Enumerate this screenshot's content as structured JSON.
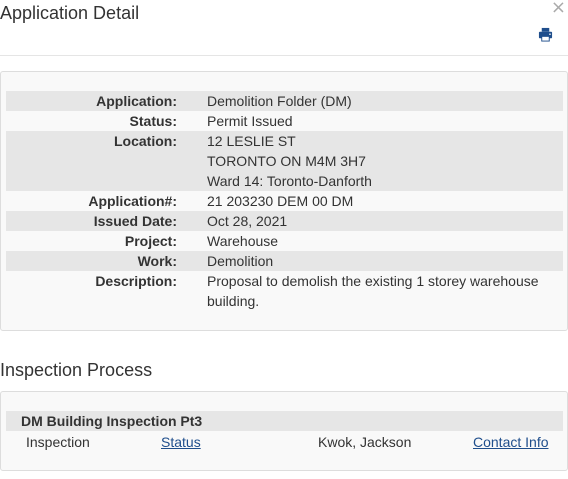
{
  "header": {
    "title": "Application Detail",
    "close_symbol": "×",
    "print_icon": "printer-icon"
  },
  "details": [
    {
      "label": "Application:",
      "value": [
        "Demolition Folder (DM)"
      ]
    },
    {
      "label": "Status:",
      "value": [
        "Permit Issued"
      ]
    },
    {
      "label": "Location:",
      "value": [
        "12 LESLIE ST",
        "TORONTO ON M4M 3H7",
        "Ward 14: Toronto-Danforth"
      ]
    },
    {
      "label": "Application#:",
      "value": [
        "21 203230 DEM 00 DM"
      ]
    },
    {
      "label": "Issued Date:",
      "value": [
        "Oct 28, 2021"
      ]
    },
    {
      "label": "Project:",
      "value": [
        "Warehouse"
      ]
    },
    {
      "label": "Work:",
      "value": [
        "Demolition"
      ]
    },
    {
      "label": "Description:",
      "value": [
        "Proposal to demolish the existing 1 storey warehouse",
        "building."
      ]
    }
  ],
  "inspection": {
    "heading": "Inspection Process",
    "group_title": "DM Building Inspection Pt3",
    "row": {
      "type": "Inspection",
      "status_link": "Status",
      "inspector": "Kwok, Jackson",
      "contact_link": "Contact Info"
    }
  },
  "colors": {
    "link": "#1f4e8c",
    "shade": "#e6e6e6",
    "panel_bg": "#f9f9f9"
  }
}
